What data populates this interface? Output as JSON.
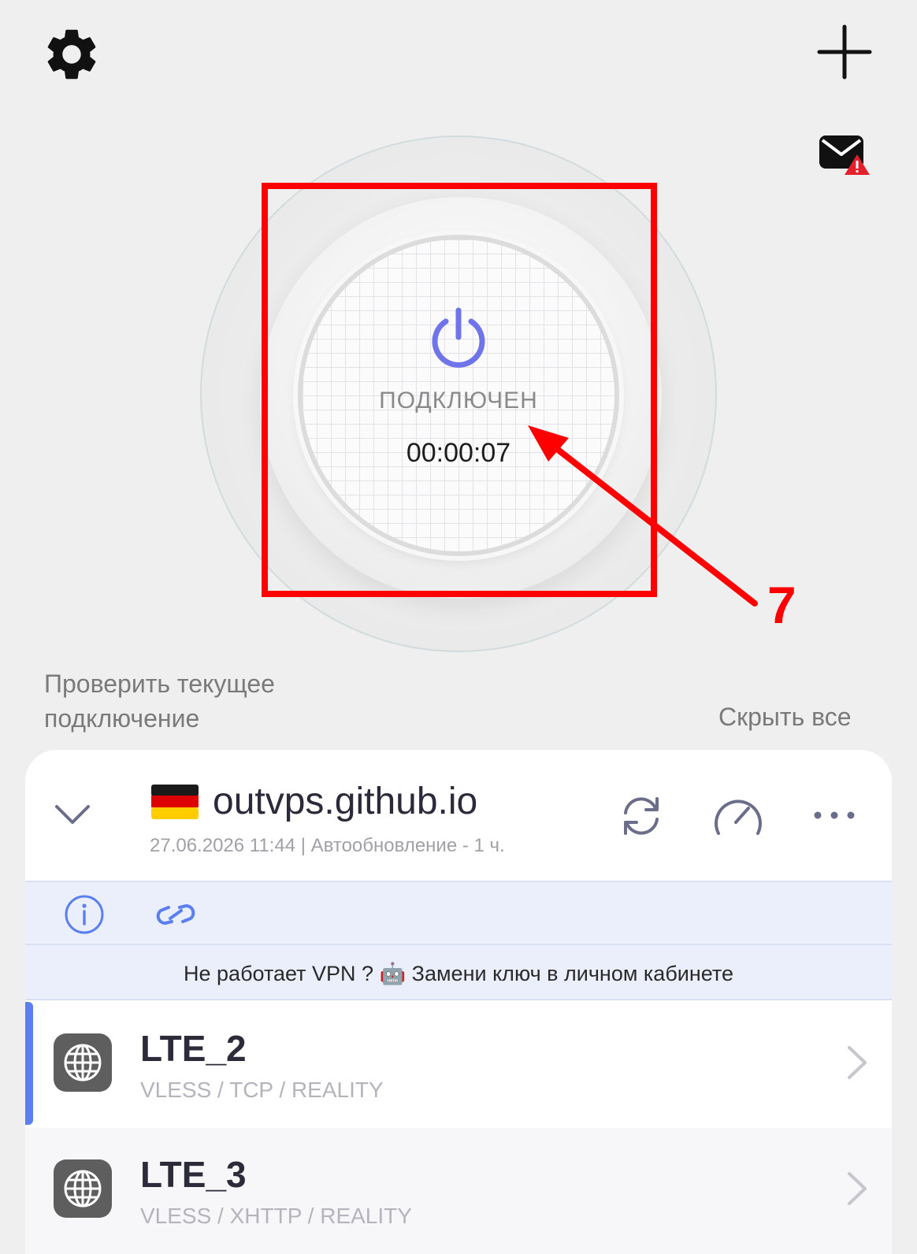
{
  "status": {
    "label": "ПОДКЛЮЧЕН",
    "timer": "00:00:07"
  },
  "links": {
    "check": "Проверить текущее подключение",
    "hide_all": "Скрыть все"
  },
  "annotation": {
    "number": "7",
    "color": "#ff0000"
  },
  "subscription": {
    "title": "outvps.github.io",
    "flag": "germany-flag",
    "meta": "27.06.2026 11:44 | Автообновление - 1 ч.",
    "notice": "Не работает VPN ? 🤖 Замени ключ в личном кабинете"
  },
  "servers": [
    {
      "name": "LTE_2",
      "protocol": "VLESS / TCP / REALITY",
      "selected": true
    },
    {
      "name": "LTE_3",
      "protocol": "VLESS / XHTTP / REALITY",
      "selected": false
    }
  ],
  "colors": {
    "accent": "#6f74ea",
    "selection": "#5b7ff0",
    "tools_bg": "#eaeffb",
    "mail_alert": "#e3202b"
  },
  "icons": [
    "gear-icon",
    "plus-icon",
    "mail-alert-icon",
    "power-icon",
    "chevron-down-icon",
    "refresh-icon",
    "speedometer-icon",
    "more-icon",
    "info-icon",
    "link-icon",
    "globe-icon",
    "chevron-right-icon"
  ]
}
